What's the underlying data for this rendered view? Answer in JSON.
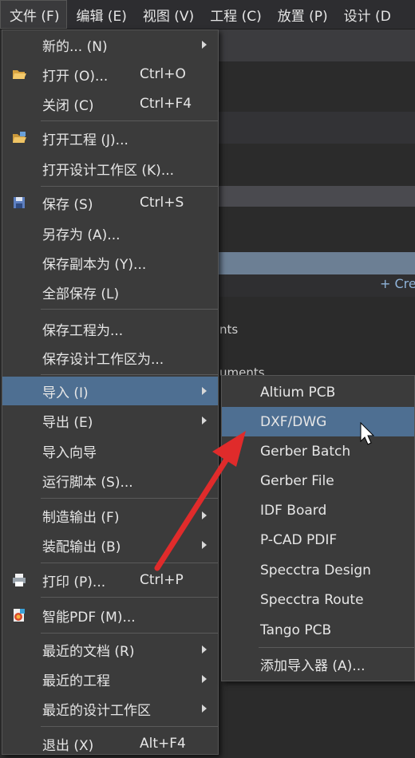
{
  "menubar": [
    "文件 (F)",
    "编辑 (E)",
    "视图 (V)",
    "工程 (C)",
    "放置 (P)",
    "设计 (D"
  ],
  "background": {
    "text_nts": "nts",
    "text_uments": "uments",
    "create_link": "+ Cre"
  },
  "file_menu": {
    "new": "新的... (N)",
    "open": "打开 (O)...",
    "open_shortcut": "Ctrl+O",
    "close": "关闭 (C)",
    "close_shortcut": "Ctrl+F4",
    "open_project": "打开工程 (J)...",
    "open_workspace": "打开设计工作区 (K)...",
    "save": "保存 (S)",
    "save_shortcut": "Ctrl+S",
    "save_as": "另存为 (A)...",
    "save_copy_as": "保存副本为 (Y)...",
    "save_all": "全部保存 (L)",
    "save_project_as": "保存工程为...",
    "save_workspace_as": "保存设计工作区为...",
    "import": "导入 (I)",
    "export": "导出 (E)",
    "import_wizard": "导入向导",
    "run_script": "运行脚本 (S)...",
    "fab_outputs": "制造输出 (F)",
    "assembly_outputs": "装配输出 (B)",
    "print": "打印 (P)...",
    "print_shortcut": "Ctrl+P",
    "smart_pdf": "智能PDF (M)...",
    "recent_docs": "最近的文档 (R)",
    "recent_projects": "最近的工程",
    "recent_workspaces": "最近的设计工作区",
    "exit": "退出 (X)",
    "exit_shortcut": "Alt+F4"
  },
  "import_submenu": {
    "items": [
      "Altium PCB",
      "DXF/DWG",
      "Gerber Batch",
      "Gerber File",
      "IDF Board",
      "P-CAD PDIF",
      "Specctra Design",
      "Specctra Route",
      "Tango PCB"
    ],
    "add_importer": "添加导入器 (A)..."
  },
  "colors": {
    "menu_bg": "#3b3b3b",
    "highlight": "#4e6f92",
    "annotation_arrow": "#e02b2b"
  }
}
